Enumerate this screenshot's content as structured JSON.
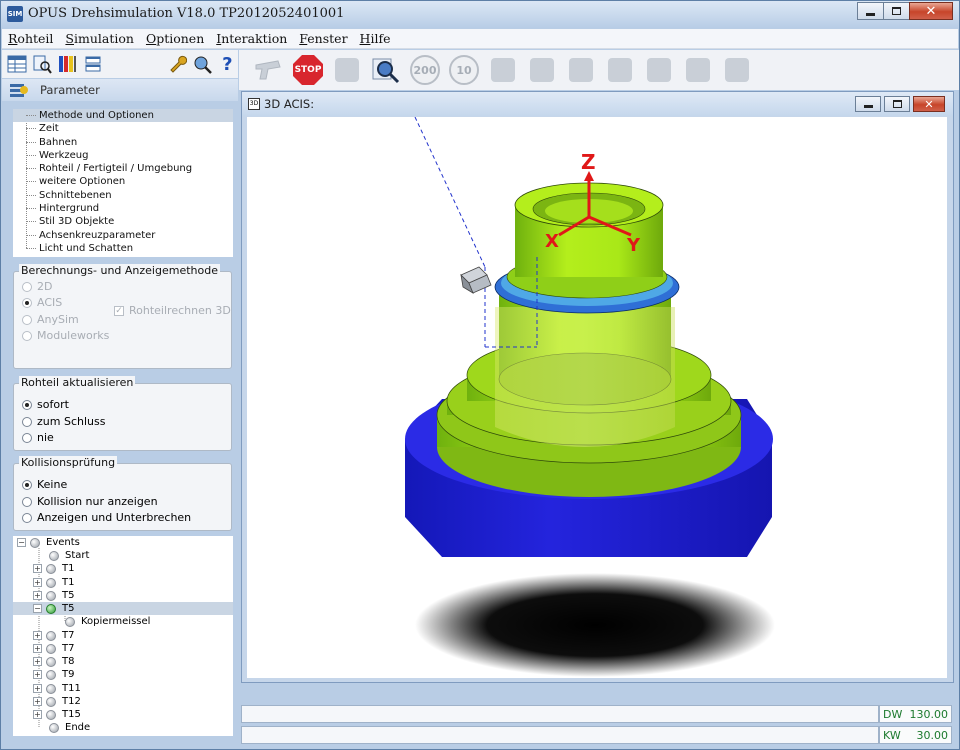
{
  "window": {
    "app_icon_text": "SIM",
    "title": "OPUS Drehsimulation V18.0  TP2012052401001"
  },
  "menu": [
    {
      "u": "R",
      "rest": "ohteil"
    },
    {
      "u": "S",
      "rest": "imulation"
    },
    {
      "u": "O",
      "rest": "ptionen"
    },
    {
      "u": "I",
      "rest": "nteraktion"
    },
    {
      "u": "F",
      "rest": "enster"
    },
    {
      "u": "H",
      "rest": "ilfe"
    }
  ],
  "toolbar": {
    "stop_label": "STOP",
    "btn_200": "200",
    "btn_10": "10"
  },
  "param_bar": {
    "label": "Parameter"
  },
  "options_tree": [
    "Methode und Optionen",
    "Zeit",
    "Bahnen",
    "Werkzeug",
    "Rohteil / Fertigteil / Umgebung",
    "weitere Optionen",
    "Schnittebenen",
    "Hintergrund",
    "Stil 3D Objekte",
    "Achsenkreuzparameter",
    "Licht und Schatten"
  ],
  "calc_group": {
    "title": "Berechnungs- und Anzeigemethode",
    "options": [
      "2D",
      "ACIS",
      "AnySim",
      "Moduleworks"
    ],
    "checkbox": "Rohteilrechnen 3D"
  },
  "rohteil_group": {
    "title": "Rohteil aktualisieren",
    "options": [
      "sofort",
      "zum Schluss",
      "nie"
    ]
  },
  "collision_group": {
    "title": "Kollisionsprüfung",
    "options": [
      "Keine",
      "Kollision nur anzeigen",
      "Anzeigen und Unterbrechen"
    ]
  },
  "events": {
    "root": "Events",
    "items": [
      "Start",
      "T1",
      "T1",
      "T5",
      "T5",
      "Kopiermeissel",
      "T7",
      "T7",
      "T8",
      "T9",
      "T11",
      "T12",
      "T15",
      "Ende"
    ]
  },
  "mdi": {
    "title": "3D ACIS:",
    "icon_text": "3D"
  },
  "axes": {
    "z": "Z",
    "x": "X",
    "y": "Y"
  },
  "status": {
    "dw_label": "DW",
    "dw_value": "130.00",
    "kw_label": "KW",
    "kw_value": "30.00"
  }
}
